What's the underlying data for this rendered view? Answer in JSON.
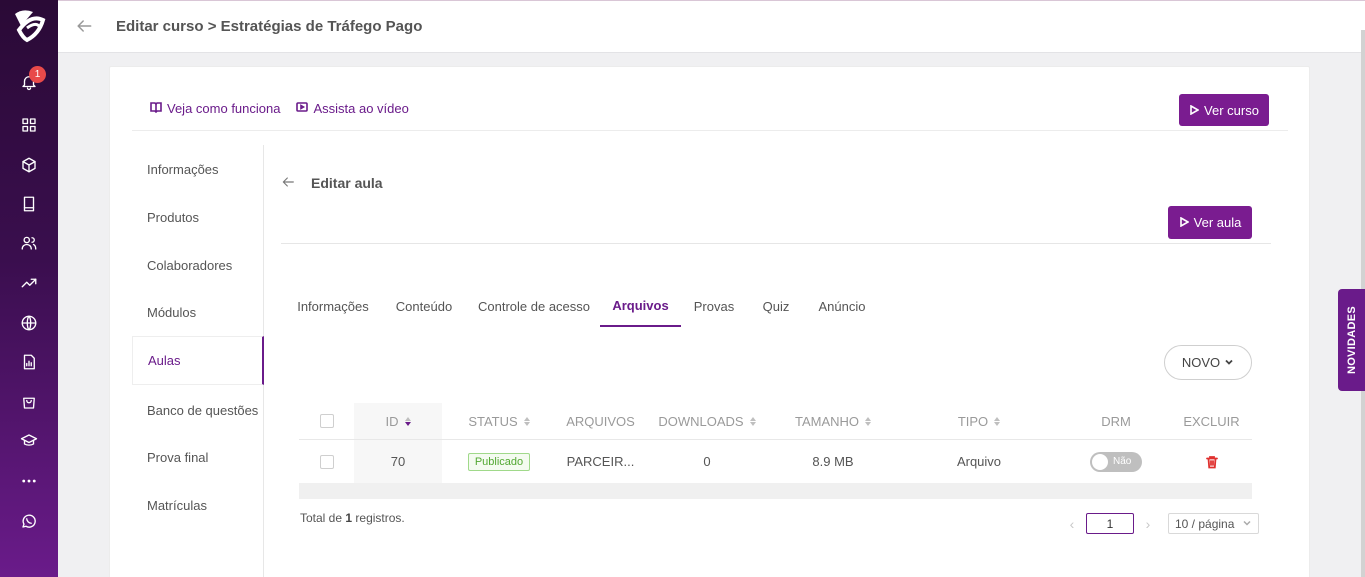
{
  "header": {
    "breadcrumb": "Editar curso > Estratégias de Tráfego Pago"
  },
  "rail": {
    "notification_count": "1"
  },
  "help": {
    "how_it_works": "Veja como funciona",
    "watch_video": "Assista ao vídeo"
  },
  "buttons": {
    "ver_curso": "Ver curso",
    "ver_aula": "Ver aula",
    "novo": "NOVO"
  },
  "side_menu": [
    "Informações",
    "Produtos",
    "Colaboradores",
    "Módulos",
    "Aulas",
    "Banco de questões",
    "Prova final",
    "Matrículas"
  ],
  "lesson": {
    "title": "Editar aula"
  },
  "tabs": [
    "Informações",
    "Conteúdo",
    "Controle de acesso",
    "Arquivos",
    "Provas",
    "Quiz",
    "Anúncio"
  ],
  "table": {
    "headers": {
      "id": "ID",
      "status": "STATUS",
      "arquivos": "ARQUIVOS",
      "downloads": "DOWNLOADS",
      "tamanho": "TAMANHO",
      "tipo": "TIPO",
      "drm": "DRM",
      "excluir": "EXCLUIR"
    },
    "rows": [
      {
        "id": "70",
        "status": "Publicado",
        "arquivo": "PARCEIR...",
        "downloads": "0",
        "tamanho": "8.9 MB",
        "tipo": "Arquivo",
        "drm": "Não"
      }
    ]
  },
  "footer": {
    "total_prefix": "Total de ",
    "total_count": "1",
    "total_suffix": " registros.",
    "current_page": "1",
    "page_size": "10 / página"
  },
  "novidades": "NOVIDADES",
  "colors": {
    "accent": "#7a1c90",
    "success": "#52a832",
    "danger": "#e0312f"
  }
}
